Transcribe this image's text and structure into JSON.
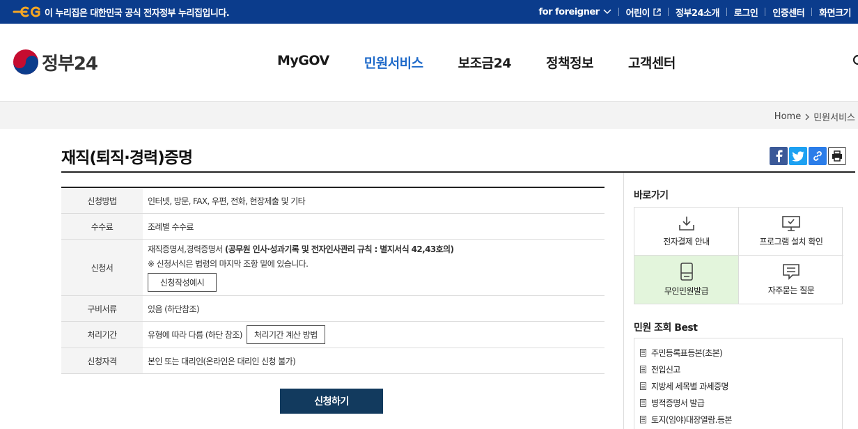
{
  "banner": {
    "text": "이 누리집은 대한민국 공식 전자정부 누리집입니다.",
    "utility": [
      {
        "label": "for foreigner"
      },
      {
        "label": "어린이"
      },
      {
        "label": "정부24소개"
      },
      {
        "label": "로그인"
      },
      {
        "label": "인증센터"
      },
      {
        "label": "화면크기"
      }
    ]
  },
  "header": {
    "logo_text": "정부24",
    "menu": [
      {
        "label": "MyGOV"
      },
      {
        "label": "민원서비스"
      },
      {
        "label": "보조금24"
      },
      {
        "label": "정책정보"
      },
      {
        "label": "고객센터"
      }
    ],
    "active_menu": "민원서비스"
  },
  "breadcrumb": {
    "home": "Home",
    "current": "민원서비스"
  },
  "page": {
    "title": "재직(퇴직·경력)증명"
  },
  "info": {
    "method_label": "신청방법",
    "method_value": "인터넷, 방문, FAX, 우편, 전화, 현장제출 및 기타",
    "fee_label": "수수료",
    "fee_value": "조례별 수수료",
    "form_label": "신청서",
    "form_value_prefix": "재직증명서,경력증명서 ",
    "form_value_strong": "(공무원 인사·성과기록 및 전자인사관리 규칙 : 별지서식 42,43호의)",
    "form_note": "※ 신청서식은 법령의 마지막 조항 밑에 있습니다.",
    "form_button": "신청작성예시",
    "docs_label": "구비서류",
    "docs_value": "있음 (하단참조)",
    "period_label": "처리기간",
    "period_value": "유형에 따라 다름 (하단 참조)",
    "period_button": "처리기간 계산 방법",
    "qualify_label": "신청자격",
    "qualify_value": "본인 또는 대리인(온라인은 대리인 신청 불가)"
  },
  "apply_button": "신청하기",
  "sidebar": {
    "quick_title": "바로가기",
    "quick": [
      {
        "label": "전자결제 안내",
        "icon": "download-icon"
      },
      {
        "label": "프로그램 설치 확인",
        "icon": "monitor-icon"
      },
      {
        "label": "무인민원발급",
        "icon": "kiosk-icon"
      },
      {
        "label": "자주묻는 질문",
        "icon": "chat-icon"
      }
    ],
    "best_title": "민원 조회 Best",
    "best": [
      {
        "label": "주민등록표등본(초본)"
      },
      {
        "label": "전입신고"
      },
      {
        "label": "지방세 세목별 과세증명"
      },
      {
        "label": "병적증명서 발급"
      },
      {
        "label": "토지(임야)대장열람.등본"
      }
    ]
  },
  "colors": {
    "banner_bg": "#0b3c8c",
    "active_menu": "#1d69c9",
    "apply_bg": "#123a5e",
    "kiosk_bg": "#e3f5dc",
    "facebook": "#3b5998",
    "twitter": "#1da1f2",
    "link": "#2b7de9"
  }
}
